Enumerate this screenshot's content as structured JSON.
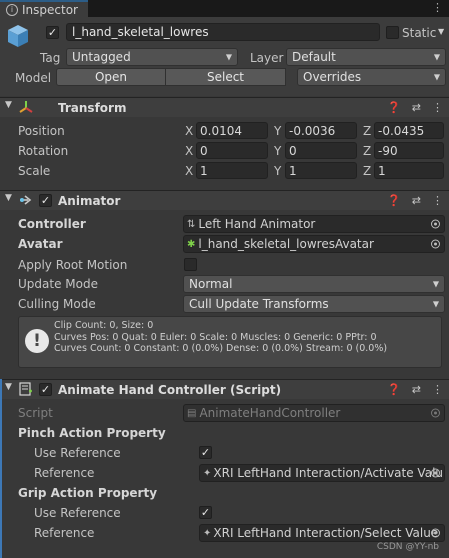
{
  "tab": {
    "label": "Inspector"
  },
  "object": {
    "name": "l_hand_skeletal_lowres",
    "static_label": "Static",
    "tag_label": "Tag",
    "tag_value": "Untagged",
    "layer_label": "Layer",
    "layer_value": "Default",
    "model_label": "Model",
    "open_label": "Open",
    "select_label": "Select",
    "overrides_label": "Overrides"
  },
  "transform": {
    "title": "Transform",
    "position_label": "Position",
    "rotation_label": "Rotation",
    "scale_label": "Scale",
    "x": "X",
    "y": "Y",
    "z": "Z",
    "position": [
      "0.0104",
      "-0.0036",
      "-0.0435"
    ],
    "rotation": [
      "0",
      "0",
      "-90"
    ],
    "scale": [
      "1",
      "1",
      "1"
    ]
  },
  "animator": {
    "title": "Animator",
    "controller_label": "Controller",
    "controller_value": "Left Hand Animator",
    "avatar_label": "Avatar",
    "avatar_value": "l_hand_skeletal_lowresAvatar",
    "apply_root_motion_label": "Apply Root Motion",
    "update_mode_label": "Update Mode",
    "update_mode_value": "Normal",
    "culling_mode_label": "Culling Mode",
    "culling_mode_value": "Cull Update Transforms",
    "info": [
      "Clip Count: 0, Size: 0",
      "Curves Pos: 0 Quat: 0 Euler: 0 Scale: 0 Muscles: 0 Generic: 0 PPtr: 0",
      "Curves Count: 0 Constant: 0 (0.0%) Dense: 0 (0.0%) Stream: 0 (0.0%)"
    ]
  },
  "script_comp": {
    "title": "Animate Hand Controller (Script)",
    "script_label": "Script",
    "script_value": "AnimateHandController",
    "pinch_label": "Pinch Action Property",
    "use_reference_label": "Use Reference",
    "reference_label": "Reference",
    "pinch_reference": "XRI LeftHand Interaction/Activate Valu",
    "grip_label": "Grip Action Property",
    "grip_reference": "XRI LeftHand Interaction/Select Value"
  },
  "watermark": "CSDN @YY-nb",
  "colors": {
    "accent": "#3d78b6",
    "panel": "#383838",
    "header": "#3e3e3e"
  }
}
